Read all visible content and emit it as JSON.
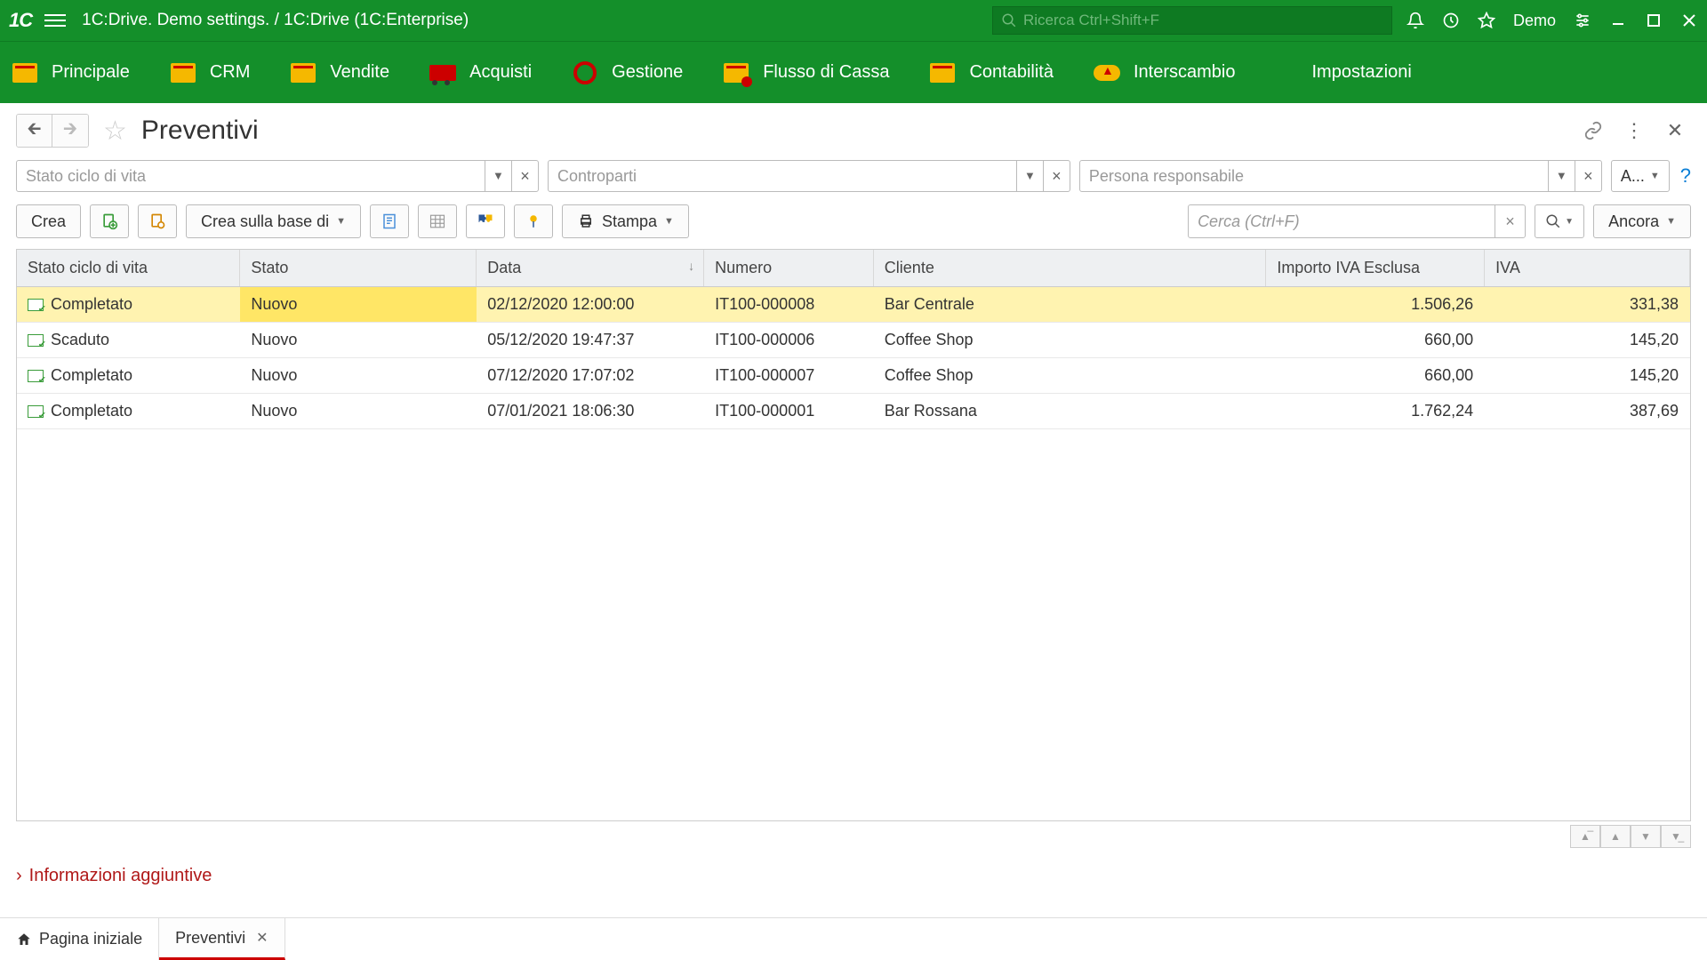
{
  "titlebar": {
    "title": "1C:Drive. Demo settings. / 1C:Drive  (1C:Enterprise)",
    "search_placeholder": "Ricerca Ctrl+Shift+F",
    "user": "Demo"
  },
  "nav": {
    "items": [
      {
        "label": "Principale"
      },
      {
        "label": "CRM"
      },
      {
        "label": "Vendite"
      },
      {
        "label": "Acquisti"
      },
      {
        "label": "Gestione"
      },
      {
        "label": "Flusso di Cassa"
      },
      {
        "label": "Contabilità"
      },
      {
        "label": "Interscambio"
      },
      {
        "label": "Impostazioni"
      }
    ]
  },
  "page": {
    "title": "Preventivi"
  },
  "filters": {
    "lifecycle_placeholder": "Stato ciclo di vita",
    "counterparty_placeholder": "Controparti",
    "responsible_placeholder": "Persona responsabile",
    "a_label": "A..."
  },
  "toolbar": {
    "create": "Crea",
    "create_based": "Crea sulla base di",
    "print": "Stampa",
    "search_placeholder": "Cerca (Ctrl+F)",
    "more": "Ancora"
  },
  "table": {
    "columns": {
      "lifecycle": "Stato ciclo di vita",
      "status": "Stato",
      "date": "Data",
      "number": "Numero",
      "customer": "Cliente",
      "amount": "Importo IVA Esclusa",
      "vat": "IVA"
    },
    "rows": [
      {
        "lifecycle": "Completato",
        "status": "Nuovo",
        "date": "02/12/2020 12:00:00",
        "number": "IT100-000008",
        "customer": "Bar Centrale",
        "amount": "1.506,26",
        "vat": "331,38",
        "selected": true
      },
      {
        "lifecycle": "Scaduto",
        "status": "Nuovo",
        "date": "05/12/2020 19:47:37",
        "number": "IT100-000006",
        "customer": "Coffee Shop",
        "amount": "660,00",
        "vat": "145,20"
      },
      {
        "lifecycle": "Completato",
        "status": "Nuovo",
        "date": "07/12/2020 17:07:02",
        "number": "IT100-000007",
        "customer": "Coffee Shop",
        "amount": "660,00",
        "vat": "145,20"
      },
      {
        "lifecycle": "Completato",
        "status": "Nuovo",
        "date": "07/01/2021 18:06:30",
        "number": "IT100-000001",
        "customer": "Bar Rossana",
        "amount": "1.762,24",
        "vat": "387,69"
      }
    ]
  },
  "info_link": "Informazioni aggiuntive",
  "bottom_tabs": {
    "home": "Pagina iniziale",
    "tab1": "Preventivi"
  }
}
